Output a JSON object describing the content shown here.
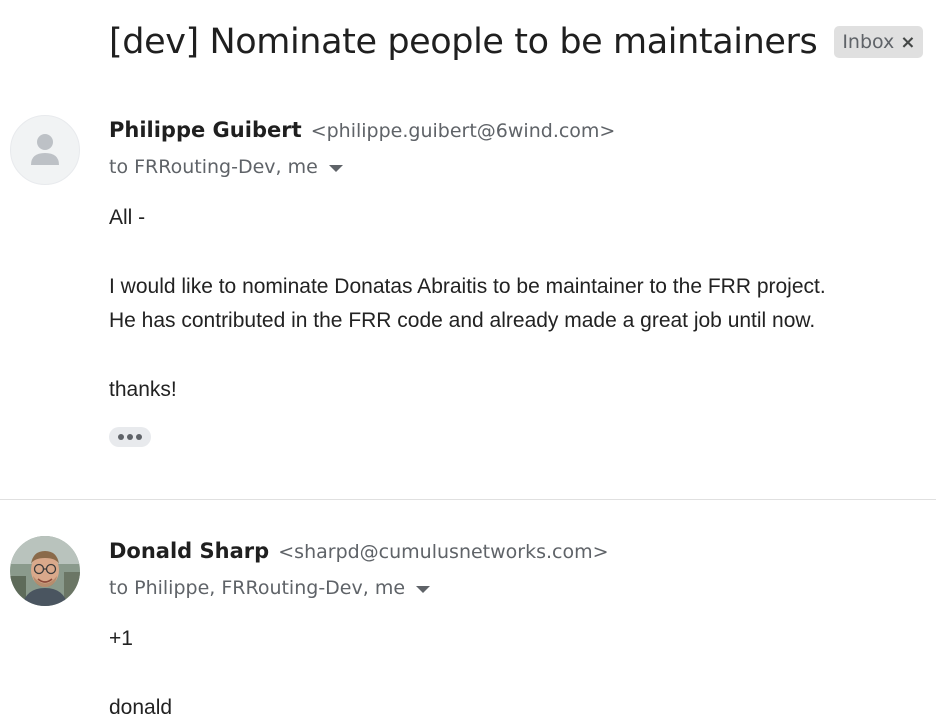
{
  "thread": {
    "subject": "[dev] Nominate people to be maintainers",
    "label": "Inbox",
    "label_remove_glyph": "×"
  },
  "messages": [
    {
      "sender_name": "Philippe Guibert",
      "sender_email": "<philippe.guibert@6wind.com>",
      "recipients": "to FRRouting-Dev, me",
      "avatar": "default-person-icon",
      "body": [
        "All -",
        "I would like to nominate Donatas Abraitis to be maintainer to the FRR project.",
        "He has contributed in the FRR code and already made a great job until now.",
        "thanks!"
      ]
    },
    {
      "sender_name": "Donald Sharp",
      "sender_email": "<sharpd@cumulusnetworks.com>",
      "recipients": "to Philippe, FRRouting-Dev, me",
      "avatar": "profile-photo",
      "body": [
        "+1",
        "donald"
      ]
    }
  ],
  "colors": {
    "chip_bg": "#e0e0e0",
    "secondary_text": "#5f6368",
    "divider": "#e0e0e0"
  }
}
